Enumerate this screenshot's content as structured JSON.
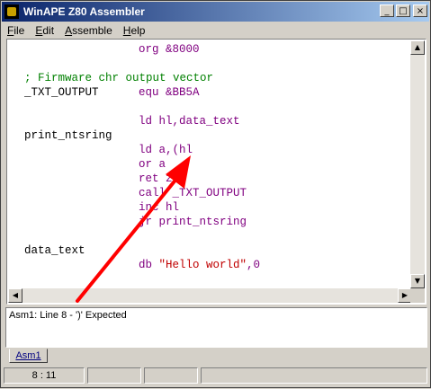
{
  "window": {
    "title": "WinAPE Z80 Assembler",
    "minimize_glyph": "_",
    "maximize_glyph": "□",
    "close_glyph": "×"
  },
  "menu": [
    "File",
    "Edit",
    "Assemble",
    "Help"
  ],
  "editor": {
    "lines": [
      {
        "label": "",
        "code": "org &8000",
        "color": "#800080"
      },
      {
        "label": "",
        "code": "",
        "color": "#000000"
      },
      {
        "label": "; Firmware chr output vector",
        "code": "",
        "color": "#008000"
      },
      {
        "label": "_TXT_OUTPUT",
        "code": "equ &BB5A",
        "color": "#800080"
      },
      {
        "label": "",
        "code": "",
        "color": "#000000"
      },
      {
        "label": "",
        "code": "ld hl,data_text",
        "color": "#800080"
      },
      {
        "label": "print_ntsring",
        "code": "",
        "color": "#000000"
      },
      {
        "label": "",
        "code": "ld a,(hl",
        "color": "#800080"
      },
      {
        "label": "",
        "code": "or a",
        "color": "#800080"
      },
      {
        "label": "",
        "code": "ret z",
        "color": "#800080"
      },
      {
        "label": "",
        "code": "call _TXT_OUTPUT",
        "color": "#800080"
      },
      {
        "label": "",
        "code": "inc hl",
        "color": "#800080"
      },
      {
        "label": "",
        "code": "jr print_ntsring",
        "color": "#800080"
      },
      {
        "label": "",
        "code": "",
        "color": "#000000"
      },
      {
        "label": "data_text",
        "code": "",
        "color": "#000000"
      },
      {
        "label": "",
        "code": "db \"Hello world\",0",
        "color": "#800080"
      }
    ],
    "string_color": "#c00000"
  },
  "output": {
    "message": "Asm1: Line 8 - ')' Expected"
  },
  "tabs": [
    "Asm1"
  ],
  "status": {
    "cursor": "8 : 11"
  },
  "colors": {
    "arrow": "#ff0000"
  }
}
